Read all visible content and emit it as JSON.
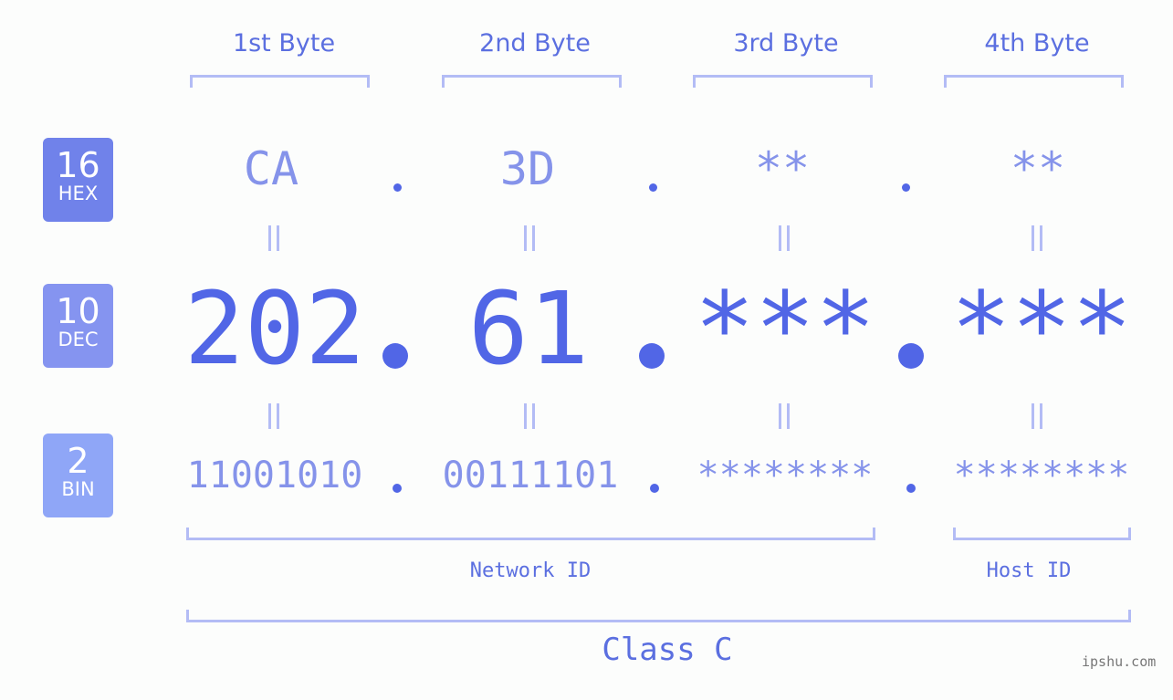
{
  "bytes": [
    {
      "label": "1st Byte",
      "hex": "CA",
      "dec": "202",
      "bin": "11001010"
    },
    {
      "label": "2nd Byte",
      "hex": "3D",
      "dec": "61",
      "bin": "00111101"
    },
    {
      "label": "3rd Byte",
      "hex": "**",
      "dec": "***",
      "bin": "********"
    },
    {
      "label": "4th Byte",
      "hex": "**",
      "dec": "***",
      "bin": "********"
    }
  ],
  "badges": {
    "hex": {
      "base": "16",
      "name": "HEX",
      "color": "#7082ea"
    },
    "dec": {
      "base": "10",
      "name": "DEC",
      "color": "#8594f0"
    },
    "bin": {
      "base": "2",
      "name": "BIN",
      "color": "#8fa6f7"
    }
  },
  "labels": {
    "network_id": "Network ID",
    "host_id": "Host ID",
    "class": "Class C"
  },
  "watermark": "ipshu.com",
  "colors": {
    "primary": "#5166e6",
    "light": "#8593ea",
    "bracket": "#b3bcf5"
  }
}
